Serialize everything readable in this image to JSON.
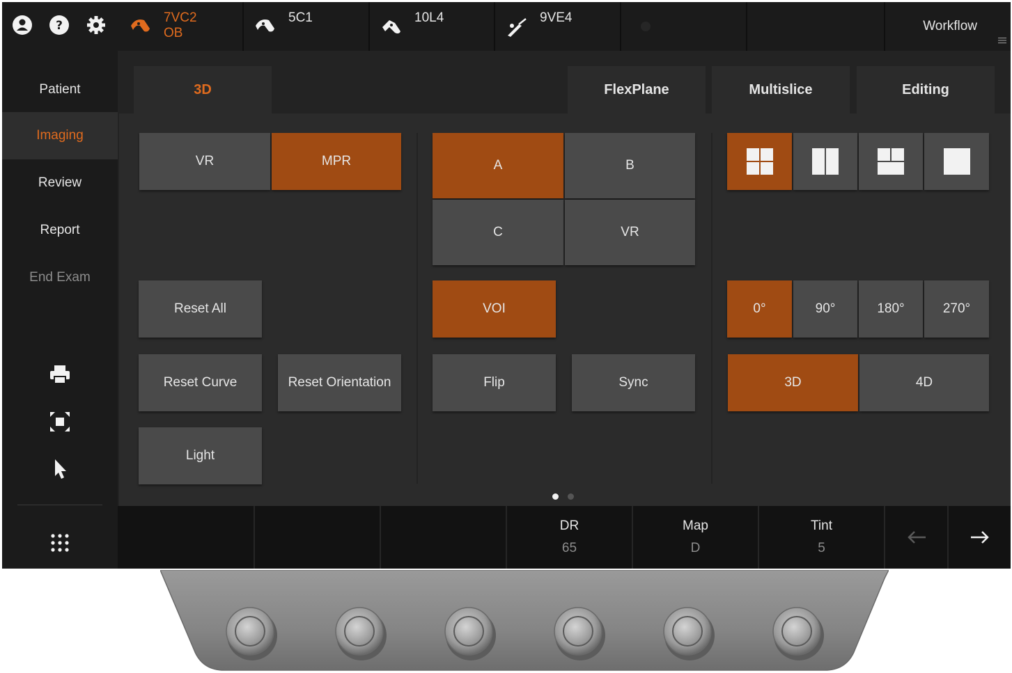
{
  "top_bar": {
    "icons": [
      "patient-icon",
      "help-icon",
      "settings-icon"
    ],
    "probes": [
      {
        "name": "7VC2",
        "preset": "OB",
        "icon": "curved-probe-icon",
        "active": true
      },
      {
        "name": "5C1",
        "preset": "",
        "icon": "curved-probe-icon",
        "active": false
      },
      {
        "name": "10L4",
        "preset": "",
        "icon": "linear-probe-icon",
        "active": false
      },
      {
        "name": "9VE4",
        "preset": "",
        "icon": "endocavity-probe-icon",
        "active": false
      }
    ],
    "workflow_label": "Workflow"
  },
  "left_nav": {
    "items": [
      {
        "label": "Patient",
        "state": "normal"
      },
      {
        "label": "Imaging",
        "state": "active"
      },
      {
        "label": "Review",
        "state": "normal"
      },
      {
        "label": "Report",
        "state": "normal"
      },
      {
        "label": "End Exam",
        "state": "disabled"
      }
    ],
    "tools": [
      "print-icon",
      "fullscreen-icon",
      "pointer-icon",
      "apps-grid-icon"
    ]
  },
  "tabs": [
    {
      "label": "3D",
      "active": true
    },
    {
      "label": "FlexPlane",
      "active": false
    },
    {
      "label": "Multislice",
      "active": false
    },
    {
      "label": "Editing",
      "active": false
    }
  ],
  "controls": {
    "render_mode": {
      "options": [
        "VR",
        "MPR"
      ],
      "selected": "MPR"
    },
    "reset_all": "Reset All",
    "reset_curve": "Reset Curve",
    "reset_orientation": "Reset Orientation",
    "light": "Light",
    "planes": {
      "options": [
        "A",
        "B",
        "C",
        "VR"
      ],
      "selected": "A"
    },
    "voi": {
      "label": "VOI",
      "on": true
    },
    "flip": "Flip",
    "sync": "Sync",
    "layouts": {
      "options": [
        "quad-layout-icon",
        "dual-layout-icon",
        "tri-layout-icon",
        "single-layout-icon"
      ],
      "selected": "quad-layout-icon"
    },
    "rotation": {
      "options": [
        "0°",
        "90°",
        "180°",
        "270°"
      ],
      "selected": "0°"
    },
    "dimension": {
      "options": [
        "3D",
        "4D"
      ],
      "selected": "3D"
    }
  },
  "pager": {
    "pages": 2,
    "current": 1
  },
  "bottom_bar": {
    "params": [
      {
        "title": "DR",
        "value": "65"
      },
      {
        "title": "Map",
        "value": "D"
      },
      {
        "title": "Tint",
        "value": "5"
      }
    ],
    "prev_icon": "arrow-left-icon",
    "next_icon": "arrow-right-icon"
  },
  "colors": {
    "accent": "#e06b1e",
    "button_on": "#a04b13",
    "button_off": "#4a4a4a",
    "panel": "#2b2b2b",
    "chrome": "#1b1b1b"
  },
  "hardware": {
    "knob_count": 6
  }
}
